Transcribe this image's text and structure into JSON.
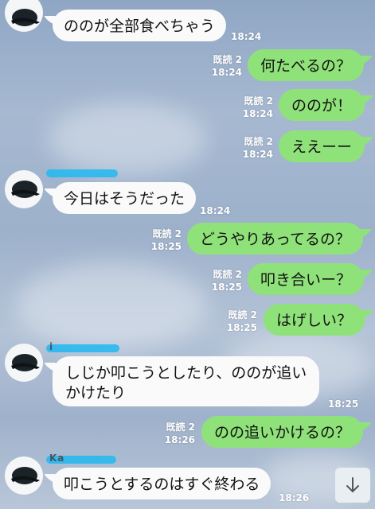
{
  "messages": [
    {
      "side": "in",
      "text": "ののが全部食べちゃう",
      "time": "18:24"
    },
    {
      "side": "out",
      "text": "何たべるの？",
      "read": "既読 2",
      "time": "18:24"
    },
    {
      "side": "out",
      "text": "ののが！",
      "read": "既読 2",
      "time": "18:24"
    },
    {
      "side": "out",
      "text": "ええーー",
      "read": "既読 2",
      "time": "18:24"
    },
    {
      "side": "in",
      "text": "今日はそうだった",
      "time": "18:24"
    },
    {
      "side": "out",
      "text": "どうやりあってるの？",
      "read": "既読 2",
      "time": "18:25"
    },
    {
      "side": "out",
      "text": "叩き合いー？",
      "read": "既読 2",
      "time": "18:25"
    },
    {
      "side": "out",
      "text": "はげしい？",
      "read": "既読 2",
      "time": "18:25"
    },
    {
      "side": "in",
      "text_line1": "しじか叩こうとしたり、ののが追い",
      "text_line2": "かけたり",
      "time": "18:25"
    },
    {
      "side": "out",
      "text": "のの追いかけるの？",
      "read": "既読 2",
      "time": "18:26"
    },
    {
      "side": "in",
      "text": "叩こうとするのはすぐ終わる",
      "time": "18:26"
    }
  ],
  "sender_names": [
    "i",
    "Ka"
  ],
  "icons": {
    "avatar": "black-cap-icon",
    "scroll": "arrow-down-icon"
  }
}
